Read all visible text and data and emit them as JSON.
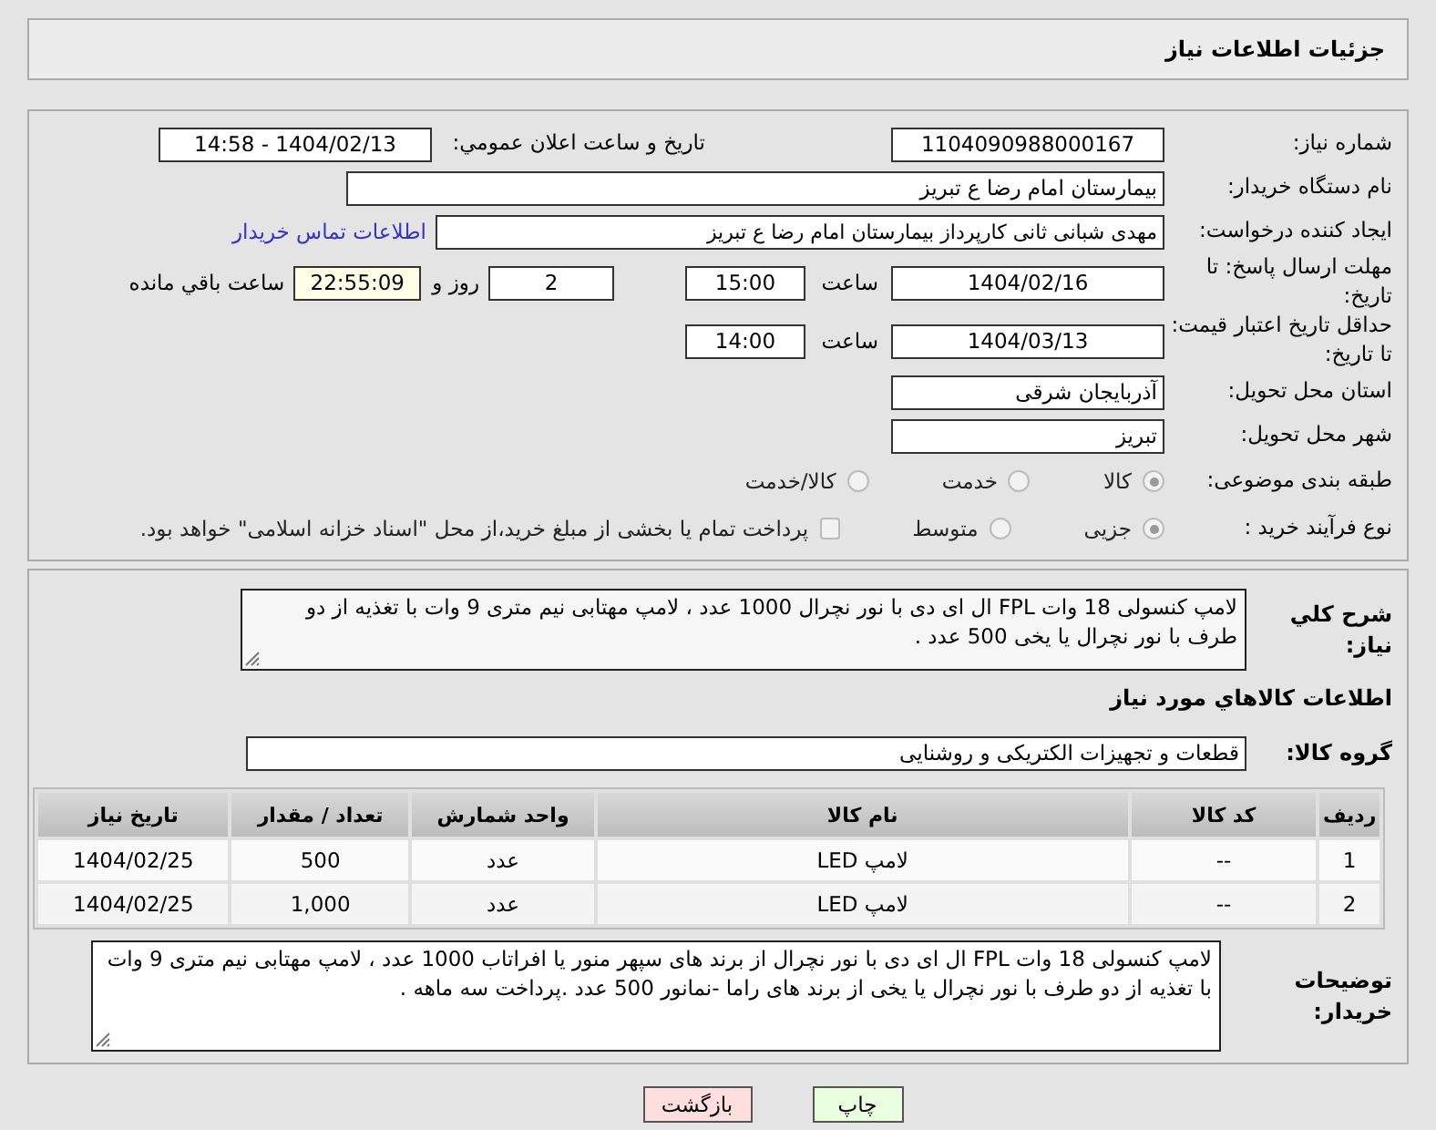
{
  "title": "جزئیات اطلاعات نیاز",
  "need_number": {
    "label": "شماره نیاز:",
    "value": "1104090988000167"
  },
  "announce": {
    "label": "تاریخ و ساعت اعلان عمومي:",
    "value": "1404/02/13 - 14:58"
  },
  "buyer_org": {
    "label": "نام دستگاه خریدار:",
    "value": "بیمارستان امام رضا  ع  تبریز"
  },
  "creator": {
    "label": "ایجاد کننده درخواست:",
    "value": "مهدی شبانی ثانی کارپرداز بیمارستان امام رضا  ع  تبریز",
    "link": "اطلاعات تماس خریدار"
  },
  "deadline": {
    "label": "مهلت ارسال پاسخ: تا تاریخ:",
    "date": "1404/02/16",
    "time_label": "ساعت",
    "time": "15:00",
    "days": "2",
    "days_label": "روز و",
    "remaining": "22:55:09",
    "remaining_label": "ساعت باقي مانده"
  },
  "price_validity": {
    "label": "حداقل تاریخ اعتبار قیمت: تا تاریخ:",
    "date": "1404/03/13",
    "time_label": "ساعت",
    "time": "14:00"
  },
  "province": {
    "label": "استان محل تحویل:",
    "value": "آذربایجان شرقی"
  },
  "city": {
    "label": "شهر محل تحویل:",
    "value": "تبریز"
  },
  "category": {
    "label": "طبقه بندی موضوعی:",
    "options": [
      {
        "label": "کالا",
        "selected": true
      },
      {
        "label": "خدمت",
        "selected": false
      },
      {
        "label": "کالا/خدمت",
        "selected": false
      }
    ]
  },
  "process": {
    "label": "نوع فرآیند خرید :",
    "options": [
      {
        "label": "جزیی",
        "selected": true
      },
      {
        "label": "متوسط",
        "selected": false
      }
    ],
    "payment": {
      "checked": false,
      "label": "پرداخت تمام یا بخشی از مبلغ خرید،از محل \"اسناد خزانه اسلامی\" خواهد بود."
    }
  },
  "description": {
    "label": "شرح کلي نياز:",
    "value": "لامپ کنسولی 18 وات FPL ال ای دی با نور نچرال  1000 عدد ، لامپ مهتابی نیم متری 9 وات با تغذیه از دو طرف با نور نچرال یا یخی  500 عدد ."
  },
  "goods_heading": "اطلاعات کالاهاي مورد نياز",
  "goods_group": {
    "label": "گروه کالا:",
    "value": "قطعات و تجهیزات الکتریکی و روشنایی"
  },
  "table": {
    "columns": [
      "ردیف",
      "کد کالا",
      "نام کالا",
      "واحد شمارش",
      "تعداد / مقدار",
      "تاریخ نیاز"
    ],
    "rows": [
      [
        "1",
        "--",
        "لامپ LED",
        "عدد",
        "500",
        "1404/02/25"
      ],
      [
        "2",
        "--",
        "لامپ LED",
        "عدد",
        "1,000",
        "1404/02/25"
      ]
    ]
  },
  "buyer_notes": {
    "label": "توضیحات خریدار:",
    "value": "لامپ کنسولی 18 وات FPL ال ای دی با نور نچرال از برند های سپهر منور یا افراتاب 1000 عدد ، لامپ مهتابی نیم متری 9 وات با تغذیه از دو طرف با نور نچرال یا یخی از برند های راما -نمانور 500 عدد .پرداخت سه ماهه ."
  },
  "buttons": [
    {
      "label": "چاپ",
      "kind": "print"
    },
    {
      "label": "بازگشت",
      "kind": "back"
    }
  ]
}
